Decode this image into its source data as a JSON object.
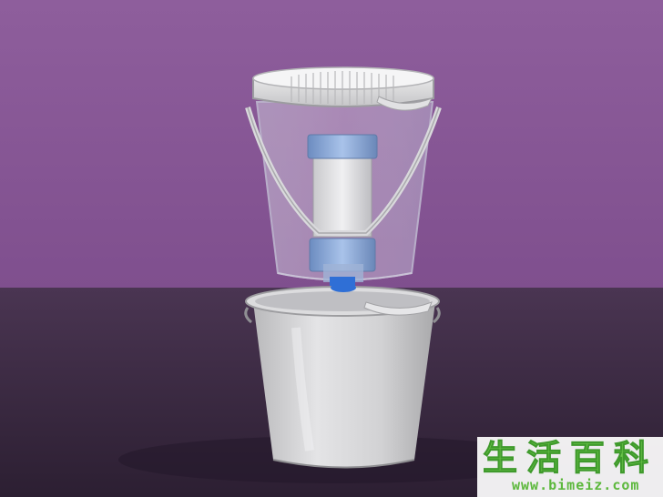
{
  "scene": {
    "description_colors": {
      "wall": "#8a5a98",
      "floor": "#3c2a44",
      "bucket": "#d8d8d8",
      "filter_band": "#7f9fcf",
      "spout": "#2f6fd6"
    }
  },
  "watermark": {
    "glyphs": "生活百科",
    "url": "www.bimeiz.com"
  }
}
